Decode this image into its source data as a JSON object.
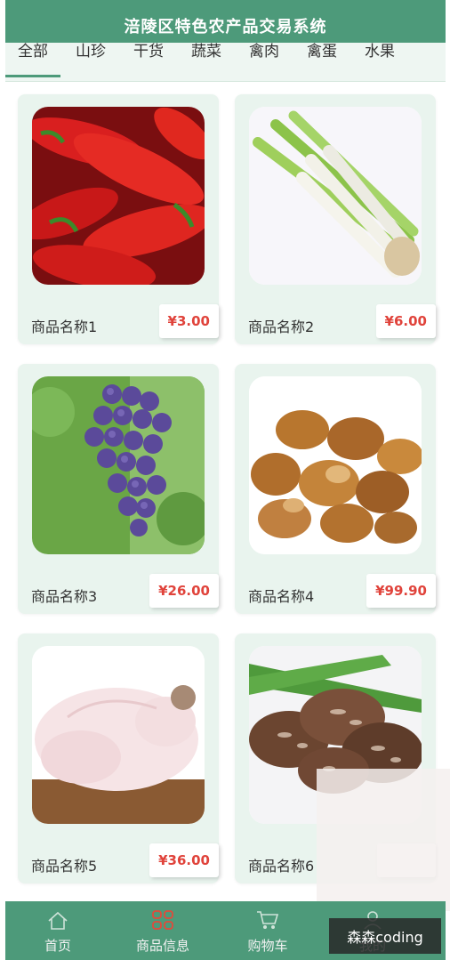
{
  "header": {
    "title": "涪陵区特色农产品交易系统"
  },
  "tabs": [
    "全部",
    "山珍",
    "干货",
    "蔬菜",
    "禽肉",
    "禽蛋",
    "水果"
  ],
  "products": [
    {
      "name": "商品名称1",
      "price": "¥3.00",
      "image": "red-chili-peppers"
    },
    {
      "name": "商品名称2",
      "price": "¥6.00",
      "image": "green-onions"
    },
    {
      "name": "商品名称3",
      "price": "¥26.00",
      "image": "grapes"
    },
    {
      "name": "商品名称4",
      "price": "¥99.90",
      "image": "dried-mushrooms"
    },
    {
      "name": "商品名称5",
      "price": "¥36.00",
      "image": "whole-chicken"
    },
    {
      "name": "商品名称6",
      "price": "",
      "image": "shiitake-mushrooms"
    }
  ],
  "tabbar": [
    {
      "label": "首页",
      "icon": "home-icon"
    },
    {
      "label": "商品信息",
      "icon": "grid-icon"
    },
    {
      "label": "购物车",
      "icon": "cart-icon"
    },
    {
      "label": "我的",
      "icon": "user-icon"
    }
  ],
  "watermark": "森森coding",
  "colors": {
    "primary": "#4d9a7a",
    "price": "#e0433b",
    "card": "#e9f4ee"
  }
}
